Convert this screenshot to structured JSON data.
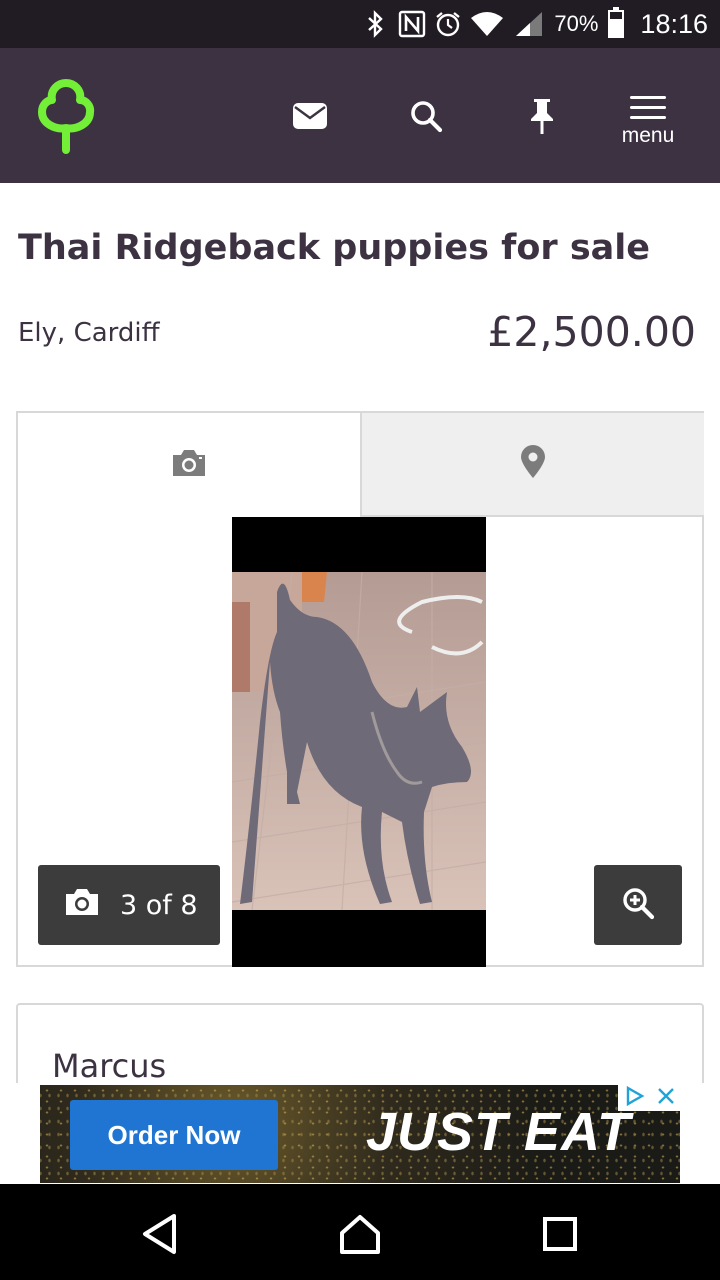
{
  "status_bar": {
    "battery": "70%",
    "battery_level": 0.7,
    "time": "18:16",
    "icons": [
      "bluetooth-icon",
      "nfc-icon",
      "alarm-icon",
      "wifi-icon",
      "signal-icon",
      "battery-icon"
    ]
  },
  "header": {
    "logo": "gumtree-tree-logo",
    "icons": [
      "mail-icon",
      "search-icon",
      "pin-icon",
      "menu-icon"
    ],
    "menu_label": "menu",
    "colors": {
      "background": "#3c3241",
      "logo": "#72ef36"
    }
  },
  "listing": {
    "title": "Thai Ridgeback puppies for sale",
    "location": "Ely, Cardiff",
    "price": "£2,500.00"
  },
  "gallery": {
    "tabs": [
      {
        "icon": "camera-icon",
        "active": true
      },
      {
        "icon": "map-marker-icon",
        "active": false
      }
    ],
    "counter": "3 of 8",
    "counter_icon": "camera-icon",
    "zoom_icon": "zoom-in-icon"
  },
  "seller": {
    "name": "Marcus"
  },
  "ad": {
    "button_label": "Order Now",
    "brand": "JUST EAT",
    "colors": {
      "button": "#1f75d1"
    }
  },
  "nav_bar": {
    "icons": [
      "back-icon",
      "home-icon",
      "recents-icon"
    ]
  }
}
